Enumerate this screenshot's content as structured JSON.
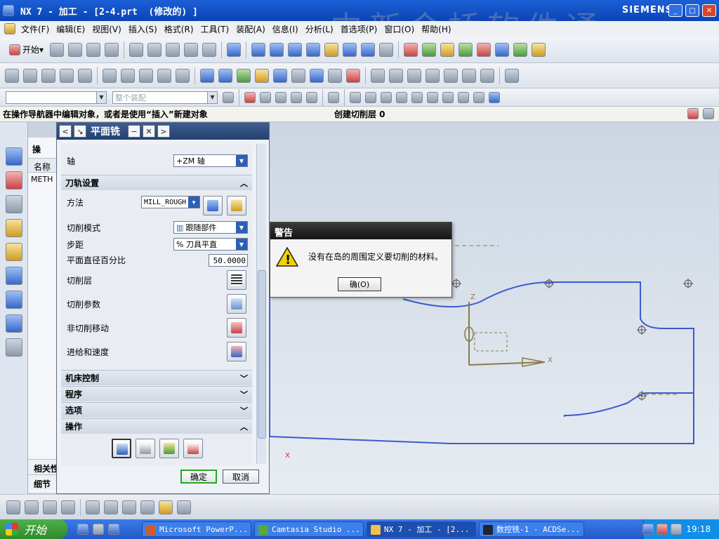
{
  "window": {
    "title": "NX 7 - 加工 - [2-4.prt  (修改的) ]",
    "brand": "SIEMENS",
    "watermark": "中新金桥软件通"
  },
  "menu": [
    "文件(F)",
    "编辑(E)",
    "视图(V)",
    "插入(S)",
    "格式(R)",
    "工具(T)",
    "装配(A)",
    "信息(I)",
    "分析(L)",
    "首选项(P)",
    "窗口(O)",
    "帮助(H)"
  ],
  "toolbar": {
    "start_label": "开始",
    "filter_placeholder": "",
    "assembly_combo": "整个装配"
  },
  "status": {
    "prompt": "在操作导航器中编辑对象，或者是使用“插入”新建对象",
    "message": "创建切削层 0"
  },
  "navigator": {
    "header": "操",
    "column_name": "名称",
    "root": "METH",
    "footer_1": "相关性",
    "footer_2": "细节"
  },
  "dialog": {
    "title": "平面铣",
    "axis": {
      "label": "轴",
      "value": "+ZM 轴"
    },
    "section_path": "刀轨设置",
    "method": {
      "label": "方法",
      "value": "MILL_ROUGH"
    },
    "cut_pattern": {
      "label": "切削模式",
      "value": "跟随部件"
    },
    "stepover": {
      "label": "步距",
      "value": "% 刀具平直"
    },
    "percent": {
      "label": "平面直径百分比",
      "value": "50.0000"
    },
    "cut_levels": "切削层",
    "cut_params": "切削参数",
    "non_cut_moves": "非切削移动",
    "feeds_speeds": "进给和速度",
    "sections": {
      "machine": "机床控制",
      "program": "程序",
      "options": "选项",
      "actions": "操作"
    },
    "ok": "确定",
    "cancel": "取消"
  },
  "warning": {
    "title": "警告",
    "message": "没有在岛的周围定义要切削的材料。",
    "ok": "确(O)"
  },
  "graphics": {
    "axis_z": "Z",
    "axis_x": "X",
    "axis_x2": "X"
  },
  "taskbar": {
    "start": "开始",
    "tasks": [
      "Microsoft PowerP...",
      "Camtasia Studio ...",
      "NX 7 - 加工 - [2...",
      "数控铣-1 - ACDSe..."
    ],
    "time": "19:18"
  },
  "colors": {
    "title_bg": "#0b44b5",
    "part_outline": "#3c5ad0",
    "tool_path": "#8a7a4a",
    "dialog_title": "#22406e"
  }
}
